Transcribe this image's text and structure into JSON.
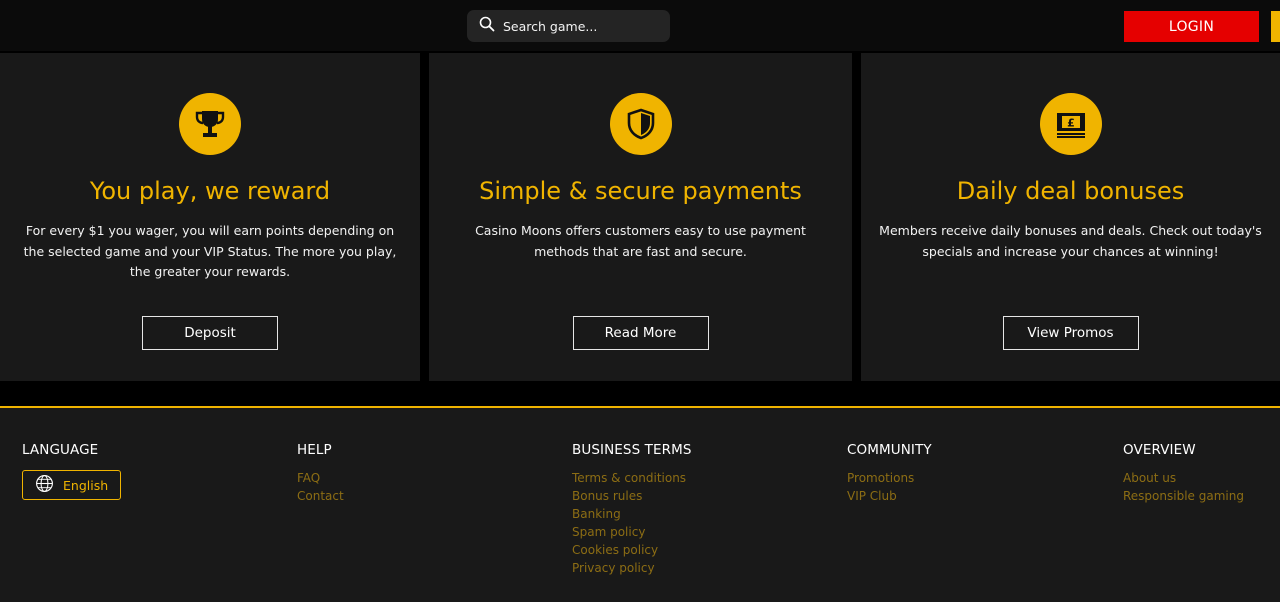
{
  "header": {
    "search_placeholder": "Search game...",
    "login_label": "LOGIN"
  },
  "cards": [
    {
      "icon": "trophy-icon",
      "title": "You play, we reward",
      "text": "For every $1 you wager, you will earn points depending on the selected game and your VIP Status. The more you play, the greater your rewards.",
      "button": "Deposit"
    },
    {
      "icon": "shield-icon",
      "title": "Simple & secure payments",
      "text": "Casino Moons offers customers easy to use payment methods that are fast and secure.",
      "button": "Read More"
    },
    {
      "icon": "money-pound-icon",
      "title": "Daily deal bonuses",
      "text": "Members receive daily bonuses and deals. Check out today's specials and increase your chances at winning!",
      "button": "View Promos"
    }
  ],
  "footer": {
    "language": {
      "heading": "LANGUAGE",
      "current": "English"
    },
    "help": {
      "heading": "HELP",
      "links": [
        "FAQ",
        "Contact"
      ]
    },
    "business": {
      "heading": "BUSINESS TERMS",
      "links": [
        "Terms & conditions",
        "Bonus rules",
        "Banking",
        "Spam policy",
        "Cookies policy",
        "Privacy policy"
      ]
    },
    "community": {
      "heading": "COMMUNITY",
      "links": [
        "Promotions",
        "VIP Club"
      ]
    },
    "overview": {
      "heading": "OVERVIEW",
      "links": [
        "About us",
        "Responsible gaming"
      ]
    }
  },
  "colors": {
    "accent": "#f0b400",
    "login": "#e50000",
    "card_bg": "#191919",
    "footer_link": "#8c6d14"
  }
}
